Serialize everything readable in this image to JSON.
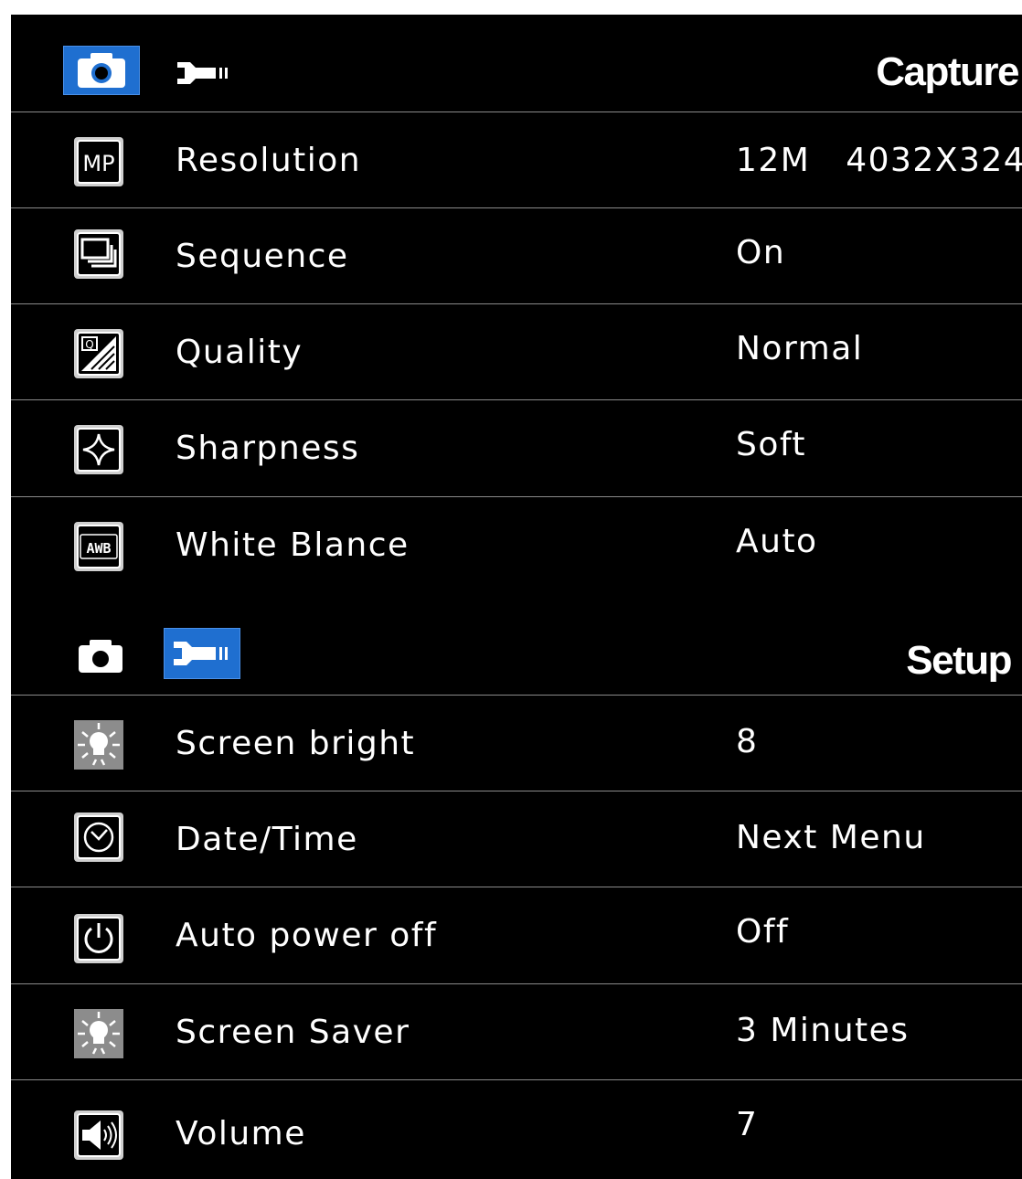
{
  "capture": {
    "title": "Capture",
    "tabs": [
      {
        "icon": "camera-icon",
        "selected": true
      },
      {
        "icon": "wrench-icon",
        "selected": false
      }
    ],
    "rows": [
      {
        "label": "Resolution",
        "value": "12M   4032X324",
        "icon": "mp-resolution-icon"
      },
      {
        "label": "Sequence",
        "value": "On",
        "icon": "sequence-frames-icon"
      },
      {
        "label": "Quality",
        "value": "Normal",
        "icon": "quality-icon"
      },
      {
        "label": "Sharpness",
        "value": "Soft",
        "icon": "sharpness-icon"
      },
      {
        "label": "White Blance",
        "value": "Auto",
        "icon": "awb-icon"
      }
    ]
  },
  "setup": {
    "title": "Setup",
    "tabs": [
      {
        "icon": "camera-icon",
        "selected": false
      },
      {
        "icon": "wrench-icon",
        "selected": true
      }
    ],
    "rows": [
      {
        "label": "Screen bright",
        "value": "8",
        "icon": "screen-brightness-icon"
      },
      {
        "label": "Date/Time",
        "value": "Next Menu",
        "icon": "clock-icon"
      },
      {
        "label": "Auto power off",
        "value": "Off",
        "icon": "power-icon"
      },
      {
        "label": "Screen Saver",
        "value": "3 Minutes",
        "icon": "screen-saver-icon"
      },
      {
        "label": "Volume",
        "value": "7",
        "icon": "speaker-icon"
      }
    ]
  },
  "colors": {
    "background": "#000000",
    "text": "#ffffff",
    "tab_highlight": "#1f6fd0",
    "separator": "#8a8a8a"
  }
}
